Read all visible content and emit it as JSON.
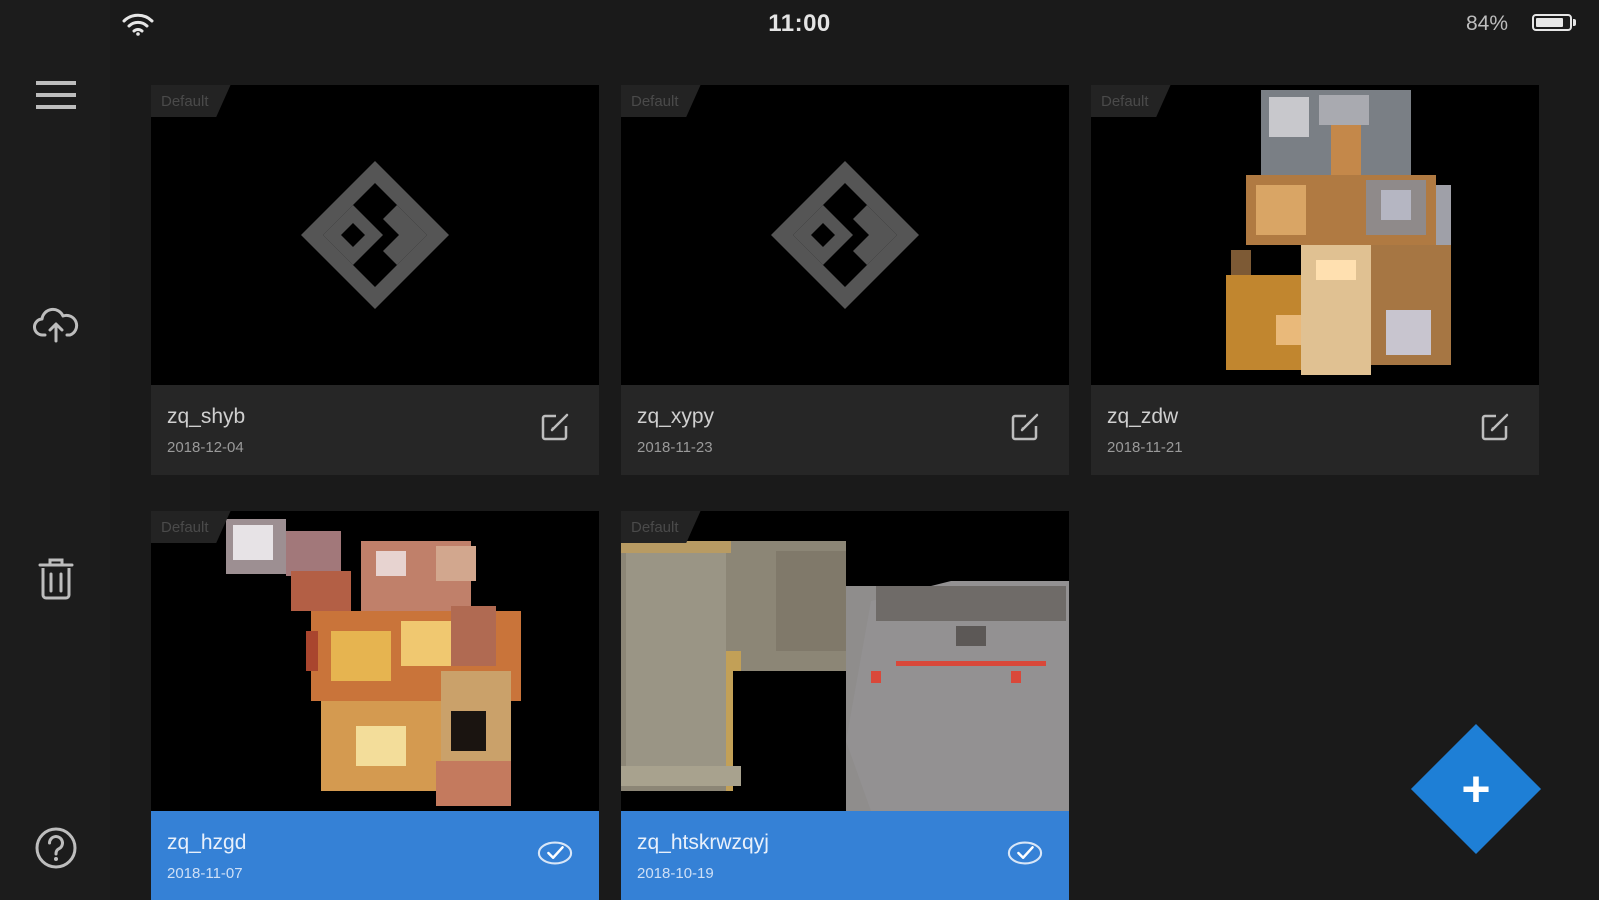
{
  "status_bar": {
    "time": "11:00",
    "battery_percent": "84%",
    "battery_level": 0.84,
    "wifi_icon": "wifi-icon"
  },
  "sidebar": {
    "items": [
      {
        "name": "menu",
        "icon": "hamburger-menu-icon"
      },
      {
        "name": "cloud-upload",
        "icon": "cloud-upload-icon"
      },
      {
        "name": "delete",
        "icon": "trash-icon"
      },
      {
        "name": "help",
        "icon": "help-icon"
      }
    ]
  },
  "projects": [
    {
      "tag": "Default",
      "name": "zq_shyb",
      "date": "2018-12-04",
      "thumbnail": "placeholder-logo",
      "selected": false,
      "action_icon": "edit-icon"
    },
    {
      "tag": "Default",
      "name": "zq_xypy",
      "date": "2018-11-23",
      "thumbnail": "placeholder-logo",
      "selected": false,
      "action_icon": "edit-icon"
    },
    {
      "tag": "Default",
      "name": "zq_zdw",
      "date": "2018-11-21",
      "thumbnail": "floorplan-scan",
      "selected": false,
      "action_icon": "edit-icon"
    },
    {
      "tag": "Default",
      "name": "zq_hzgd",
      "date": "2018-11-07",
      "thumbnail": "floorplan-scan",
      "selected": true,
      "action_icon": "check-circle-icon"
    },
    {
      "tag": "Default",
      "name": "zq_htskrwzqyj",
      "date": "2018-10-19",
      "thumbnail": "floorplan-scan",
      "selected": true,
      "action_icon": "check-circle-icon"
    }
  ],
  "fab": {
    "label": "+",
    "icon": "add-icon"
  },
  "colors": {
    "background": "#1a1a1a",
    "sidebar": "#1c1c1c",
    "card": "#262626",
    "selected": "#3581d6",
    "accent": "#1e7fd6"
  }
}
